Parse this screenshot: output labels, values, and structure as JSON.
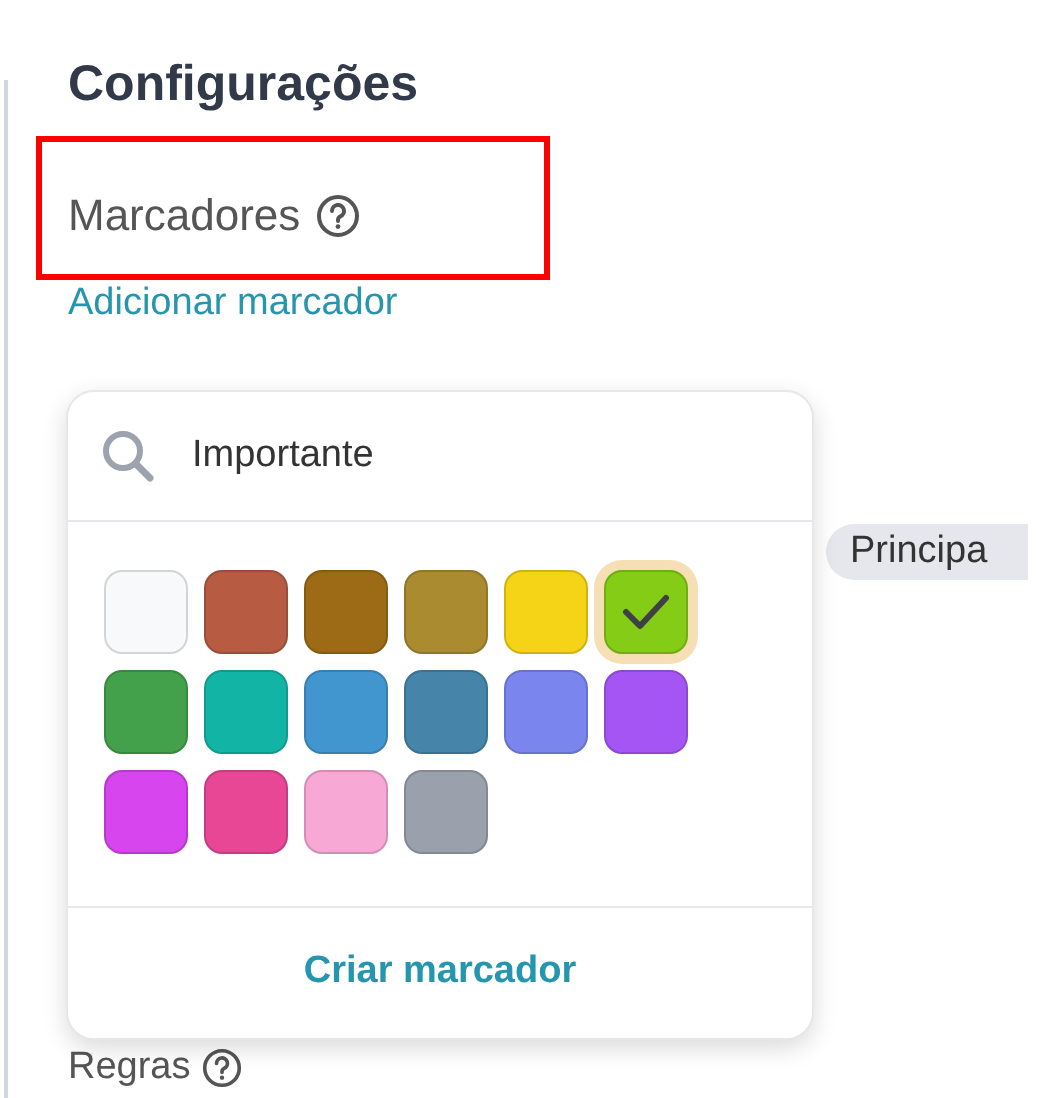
{
  "page": {
    "title": "Configurações"
  },
  "markers_section": {
    "label": "Marcadores",
    "add_link": "Adicionar marcador"
  },
  "tag": {
    "label": "Principa"
  },
  "rules_section": {
    "label": "Regras"
  },
  "marker_popup": {
    "search": {
      "value": "Importante"
    },
    "colors": [
      {
        "color": "#f8f9fb",
        "selected": false
      },
      {
        "color": "#b85b43",
        "selected": false
      },
      {
        "color": "#9d6b16",
        "selected": false
      },
      {
        "color": "#ab8b30",
        "selected": false
      },
      {
        "color": "#f5d316",
        "selected": false
      },
      {
        "color": "#84cc16",
        "selected": true
      },
      {
        "color": "#43a04b",
        "selected": false
      },
      {
        "color": "#12b5a5",
        "selected": false
      },
      {
        "color": "#4296cf",
        "selected": false
      },
      {
        "color": "#4684aa",
        "selected": false
      },
      {
        "color": "#7a86ee",
        "selected": false
      },
      {
        "color": "#a655f5",
        "selected": false
      },
      {
        "color": "#d645ee",
        "selected": false
      },
      {
        "color": "#e84796",
        "selected": false
      },
      {
        "color": "#f7a8d4",
        "selected": false
      },
      {
        "color": "#9aa1ac",
        "selected": false
      }
    ],
    "create_button": "Criar marcador"
  }
}
